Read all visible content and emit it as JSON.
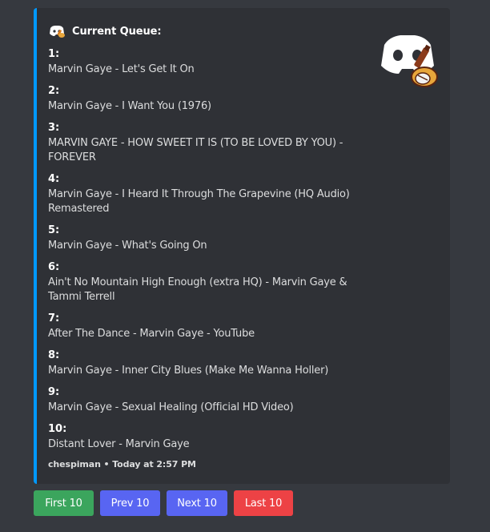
{
  "embed": {
    "author": "Current Queue:",
    "accent_color": "#0099ff",
    "items": [
      {
        "number": "1:",
        "title": "Marvin Gaye - Let's Get It On"
      },
      {
        "number": "2:",
        "title": "Marvin Gaye - I Want You (1976)"
      },
      {
        "number": "3:",
        "title": "MARVIN GAYE - HOW SWEET IT IS (TO BE LOVED BY YOU) - FOREVER"
      },
      {
        "number": "4:",
        "title": "Marvin Gaye - I Heard It Through The Grapevine (HQ Audio) Remastered"
      },
      {
        "number": "5:",
        "title": "Marvin Gaye - What's Going On"
      },
      {
        "number": "6:",
        "title": "Ain't No Mountain High Enough (extra HQ) - Marvin Gaye & Tammi Terrell"
      },
      {
        "number": "7:",
        "title": "After The Dance - Marvin Gaye - YouTube"
      },
      {
        "number": "8:",
        "title": "Marvin Gaye - Inner City Blues (Make Me Wanna Holler)"
      },
      {
        "number": "9:",
        "title": "Marvin Gaye - Sexual Healing (Official HD Video)"
      },
      {
        "number": "10:",
        "title": "Distant Lover - Marvin Gaye"
      }
    ],
    "footer": "chespiman • Today at 2:57 PM"
  },
  "buttons": {
    "first": "First 10",
    "prev": "Prev 10",
    "next": "Next 10",
    "last": "Last 10"
  },
  "icons": {
    "author_icon": "discord-music-bot-icon",
    "thumbnail": "discord-music-bot-logo"
  }
}
